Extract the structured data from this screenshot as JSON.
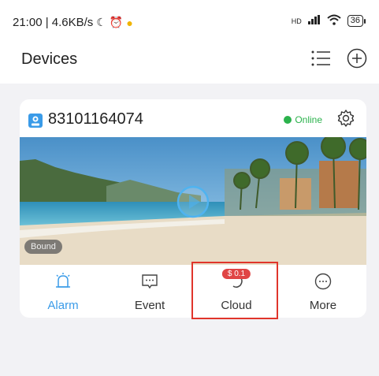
{
  "status_bar": {
    "time_speed": "21:00 | 4.6KB/s",
    "network": "HD",
    "battery": "36"
  },
  "header": {
    "title": "Devices"
  },
  "device": {
    "id": "83101164074",
    "status": "Online",
    "status_color": "#2bb24c",
    "preview_badge": "Bound"
  },
  "actions": [
    {
      "label": "Alarm",
      "icon": "alarm-bell-icon"
    },
    {
      "label": "Event",
      "icon": "event-message-icon"
    },
    {
      "label": "Cloud",
      "icon": "cloud-icon",
      "badge": "$ 0.1"
    },
    {
      "label": "More",
      "icon": "more-icon"
    }
  ],
  "colors": {
    "accent": "#3a9be8",
    "badge": "#e04545",
    "highlight": "#e0352b"
  }
}
